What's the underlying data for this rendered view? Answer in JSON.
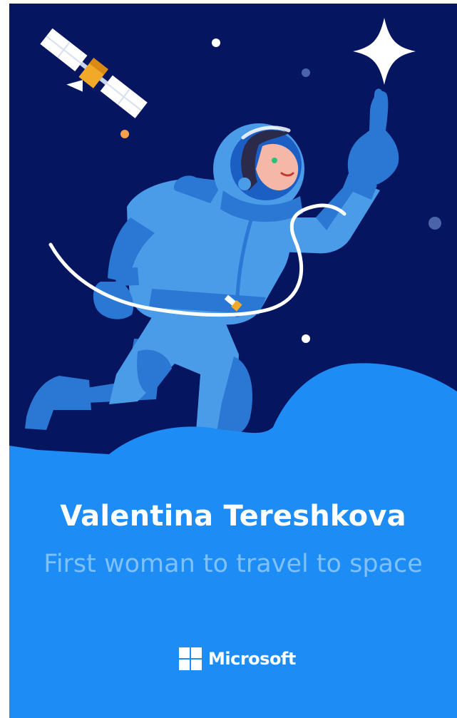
{
  "card": {
    "title": "Valentina Tereshkova",
    "subtitle": "First woman to travel to space",
    "brand_name": "Microsoft"
  },
  "icons": {
    "satellite": "satellite-icon",
    "sparkle_star": "sparkle-star-icon",
    "astronaut": "astronaut-illustration",
    "logo": "microsoft-logo-icon"
  },
  "colors": {
    "space_background": "#061560",
    "cloud_blue": "#1e8cf5",
    "suit_light": "#4a9be8",
    "suit_dark": "#2a78d4",
    "title_text": "#ffffff",
    "subtitle_text": "#7ec1fb",
    "satellite_gold": "#f2a92a",
    "dot_orange": "#f9a04b"
  }
}
